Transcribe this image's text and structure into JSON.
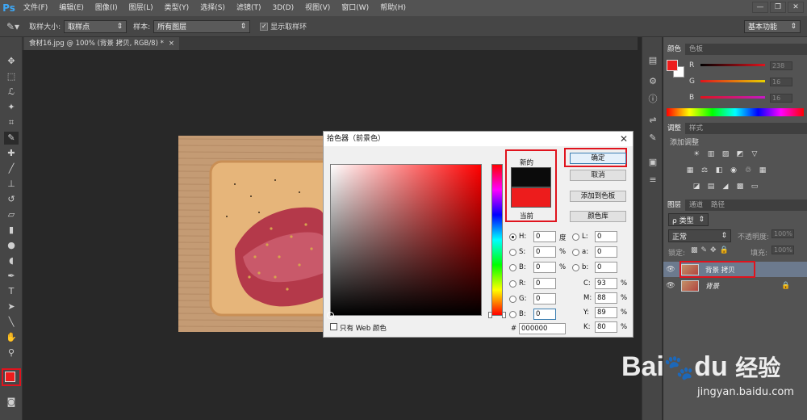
{
  "app": {
    "logo": "Ps",
    "menu": [
      "文件(F)",
      "编辑(E)",
      "图像(I)",
      "图层(L)",
      "类型(Y)",
      "选择(S)",
      "滤镜(T)",
      "3D(D)",
      "视图(V)",
      "窗口(W)",
      "帮助(H)"
    ],
    "window_controls": [
      "—",
      "❐",
      "✕"
    ]
  },
  "options": {
    "tool_icon": "eyedropper-icon",
    "sample_size_label": "取样大小:",
    "sample_size_value": "取样点",
    "sample_label": "样本:",
    "sample_value": "所有图层",
    "show_ring_label": "显示取样环",
    "show_ring_checked": true,
    "workspace": "基本功能"
  },
  "document": {
    "tab_title": "食材16.jpg @ 100% (背景 拷贝, RGB/8) *",
    "tab_close": "×"
  },
  "dialog": {
    "title": "拾色器（前景色）",
    "close": "✕",
    "new_label": "新的",
    "current_label": "当前",
    "new_color": "#0b0b0b",
    "current_color": "#ed1c1c",
    "ok": "确定",
    "cancel": "取消",
    "add_swatch": "添加到色板",
    "libraries": "颜色库",
    "hsb": [
      {
        "label": "H:",
        "value": "0",
        "unit": "度",
        "selected": true
      },
      {
        "label": "S:",
        "value": "0",
        "unit": "%",
        "selected": false
      },
      {
        "label": "B:",
        "value": "0",
        "unit": "%",
        "selected": false
      }
    ],
    "rgb": [
      {
        "label": "R:",
        "value": "0"
      },
      {
        "label": "G:",
        "value": "0"
      },
      {
        "label": "B:",
        "value": "0"
      }
    ],
    "lab": [
      {
        "label": "L:",
        "value": "0"
      },
      {
        "label": "a:",
        "value": "0"
      },
      {
        "label": "b:",
        "value": "0"
      }
    ],
    "cmyk": [
      {
        "label": "C:",
        "value": "93",
        "unit": "%"
      },
      {
        "label": "M:",
        "value": "88",
        "unit": "%"
      },
      {
        "label": "Y:",
        "value": "89",
        "unit": "%"
      },
      {
        "label": "K:",
        "value": "80",
        "unit": "%"
      }
    ],
    "hash": "#",
    "hex": "000000",
    "web_only": "只有 Web 颜色"
  },
  "color_panel": {
    "tabs": [
      "颜色",
      "色板"
    ],
    "channels": [
      {
        "label": "R",
        "value": "238",
        "color": "#e0131d"
      },
      {
        "label": "G",
        "value": "16",
        "color": "#e8d000"
      },
      {
        "label": "B",
        "value": "16",
        "color": "#c41ac4"
      }
    ]
  },
  "adjust_panel": {
    "tabs": [
      "调整",
      "样式"
    ],
    "hint": "添加调整"
  },
  "layers_panel": {
    "tabs": [
      "图层",
      "通道",
      "路径"
    ],
    "filter": "ρ 类型",
    "blend": "正常",
    "opacity_label": "不透明度:",
    "opacity": "100%",
    "lock_label": "锁定:",
    "fill_label": "填充:",
    "fill": "100%",
    "layers": [
      {
        "name": "背景 拷贝",
        "selected": true,
        "locked": false
      },
      {
        "name": "背景",
        "selected": false,
        "locked": true
      }
    ]
  },
  "watermark": {
    "brand": "Bai",
    "brand2": "du",
    "cn": "经验",
    "url": "jingyan.baidu.com"
  }
}
